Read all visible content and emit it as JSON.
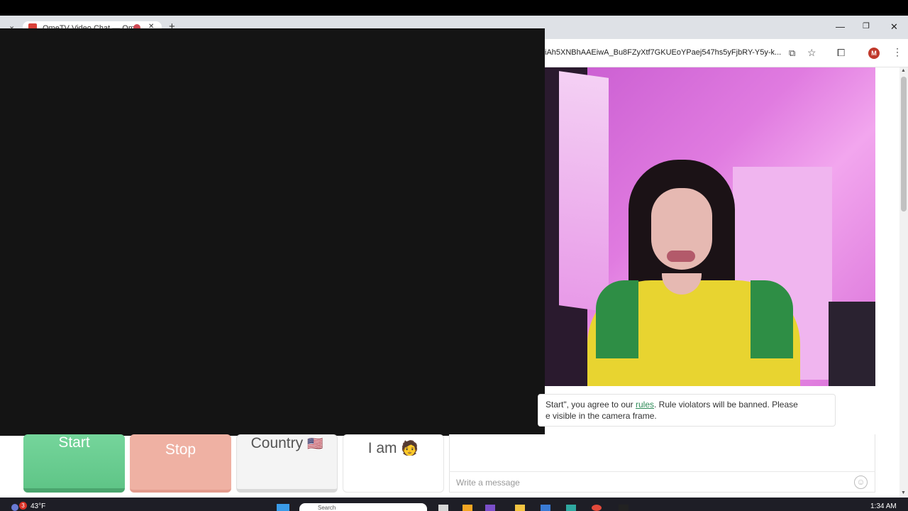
{
  "browser": {
    "tab_title": "OmeTV Video Chat — Ome",
    "tab_close": "✕",
    "new_tab": "+",
    "tab_list": "⌄",
    "address": "iAh5XNBhAAEiwA_Bu8FZyXtf7GKUEoYPaej547hs5yFjbRY-Y5y-k...",
    "profile_initial": "M",
    "window_controls": [
      "—",
      "❐",
      "✕"
    ]
  },
  "chat": {
    "notice_prefix": "Start\", you agree to our ",
    "notice_link": "rules",
    "notice_suffix": ". Rule violators will be banned. Please",
    "notice_line2": "e visible in the camera frame.",
    "buttons": {
      "start": "Start",
      "stop": "Stop",
      "country": "Country",
      "country_flag": "🇺🇸",
      "iam": "I am",
      "iam_emoji": "🧑"
    },
    "message_placeholder": "Write a message"
  },
  "taskbar": {
    "weather_badge": "3",
    "weather": "43°F",
    "search": "Search",
    "time": "1:34 AM"
  },
  "colors": {
    "start": "#5fc587",
    "stop": "#efb1a3",
    "link": "#2e8b57",
    "overlay": "#141414"
  }
}
